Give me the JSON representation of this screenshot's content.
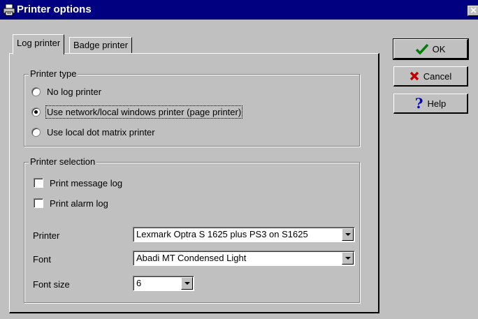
{
  "window": {
    "title": "Printer options",
    "close_label": "✕"
  },
  "tabs": [
    {
      "label": "Log printer",
      "active": true
    },
    {
      "label": "Badge printer",
      "active": false
    }
  ],
  "printer_type": {
    "title": "Printer type",
    "options": [
      {
        "label": "No log printer",
        "checked": false
      },
      {
        "label": "Use network/local windows printer (page printer)",
        "checked": true
      },
      {
        "label": "Use local dot matrix printer",
        "checked": false
      }
    ]
  },
  "printer_selection": {
    "title": "Printer selection",
    "checks": [
      {
        "label": "Print message log",
        "checked": false
      },
      {
        "label": "Print alarm log",
        "checked": false
      }
    ],
    "printer_label": "Printer",
    "printer_value": "Lexmark Optra S 1625 plus PS3 on S1625",
    "font_label": "Font",
    "font_value": "Abadi MT Condensed Light",
    "font_size_label": "Font size",
    "font_size_value": "6"
  },
  "buttons": {
    "ok": "OK",
    "cancel": "Cancel",
    "help": "Help"
  },
  "colors": {
    "titlebar": "#000080",
    "face": "#c0c0c0",
    "ok_check": "#008000",
    "cancel_x": "#c00000",
    "help_q": "#0000c0"
  }
}
